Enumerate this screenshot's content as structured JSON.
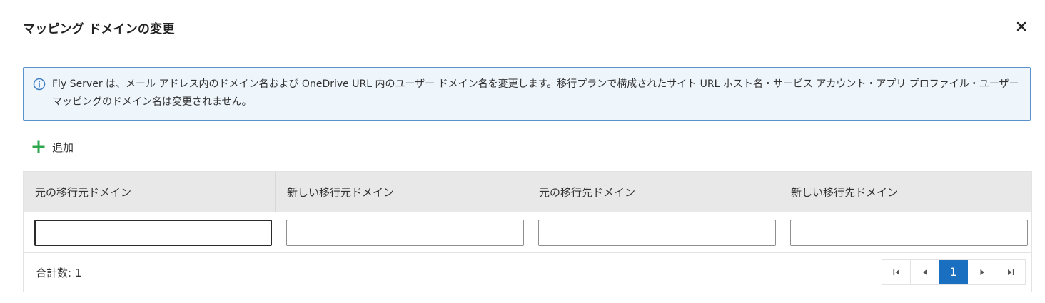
{
  "dialog": {
    "title": "マッピング ドメインの変更",
    "close_icon": "close-icon"
  },
  "info": {
    "icon": "info-circle-icon",
    "text": "Fly Server は、メール アドレス内のドメイン名および OneDrive URL 内のユーザー ドメイン名を変更します。移行プランで構成されたサイト URL ホスト名・サービス アカウント・アプリ プロファイル・ユーザー マッピングのドメイン名は変更されません。",
    "color": "#5a93c9"
  },
  "toolbar": {
    "add_label": "追加",
    "add_icon": "plus-icon",
    "add_color": "#2ea64e"
  },
  "table": {
    "columns": [
      "元の移行元ドメイン",
      "新しい移行元ドメイン",
      "元の移行先ドメイン",
      "新しい移行先ドメイン"
    ],
    "rows": [
      [
        "",
        "",
        "",
        ""
      ]
    ]
  },
  "footer": {
    "total_label": "合計数: 1"
  },
  "pagination": {
    "current_page": "1",
    "first_icon": "first-page-icon",
    "prev_icon": "previous-page-icon",
    "next_icon": "next-page-icon",
    "last_icon": "last-page-icon",
    "active_color": "#1a6fc0"
  }
}
